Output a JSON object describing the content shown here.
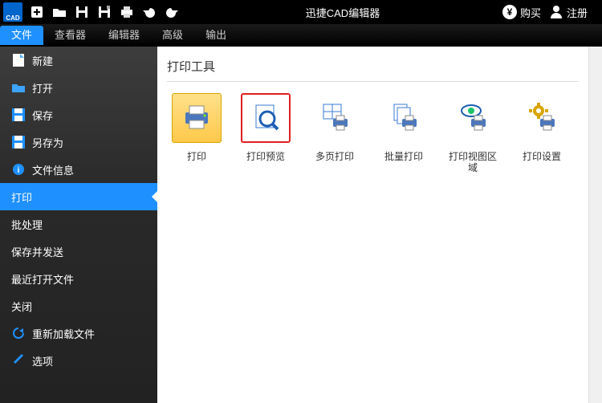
{
  "titlebar": {
    "app_logo_text": "CAD",
    "title": "迅捷CAD编辑器",
    "buy": "购买",
    "register": "注册",
    "yen": "¥"
  },
  "menubar": {
    "tabs": [
      {
        "label": "文件",
        "active": true
      },
      {
        "label": "查看器",
        "active": false
      },
      {
        "label": "编辑器",
        "active": false
      },
      {
        "label": "高级",
        "active": false
      },
      {
        "label": "输出",
        "active": false
      }
    ]
  },
  "sidebar": {
    "items": [
      {
        "label": "新建",
        "icon": "file-new-icon"
      },
      {
        "label": "打开",
        "icon": "folder-open-icon"
      },
      {
        "label": "保存",
        "icon": "save-icon"
      },
      {
        "label": "另存为",
        "icon": "save-as-icon"
      },
      {
        "label": "文件信息",
        "icon": "info-icon"
      },
      {
        "label": "打印",
        "icon": null,
        "selected": true
      },
      {
        "label": "批处理",
        "icon": null
      },
      {
        "label": "保存并发送",
        "icon": null
      },
      {
        "label": "最近打开文件",
        "icon": null
      },
      {
        "label": "关闭",
        "icon": null
      },
      {
        "label": "重新加载文件",
        "icon": "refresh-icon"
      },
      {
        "label": "选项",
        "icon": "wrench-icon"
      }
    ]
  },
  "main": {
    "panel_title": "打印工具",
    "tools": [
      {
        "label": "打印",
        "state": "selected"
      },
      {
        "label": "打印预览",
        "state": "highlighted"
      },
      {
        "label": "多页打印",
        "state": "normal"
      },
      {
        "label": "批量打印",
        "state": "normal"
      },
      {
        "label": "打印视图区域",
        "state": "normal"
      },
      {
        "label": "打印设置",
        "state": "normal"
      }
    ]
  }
}
